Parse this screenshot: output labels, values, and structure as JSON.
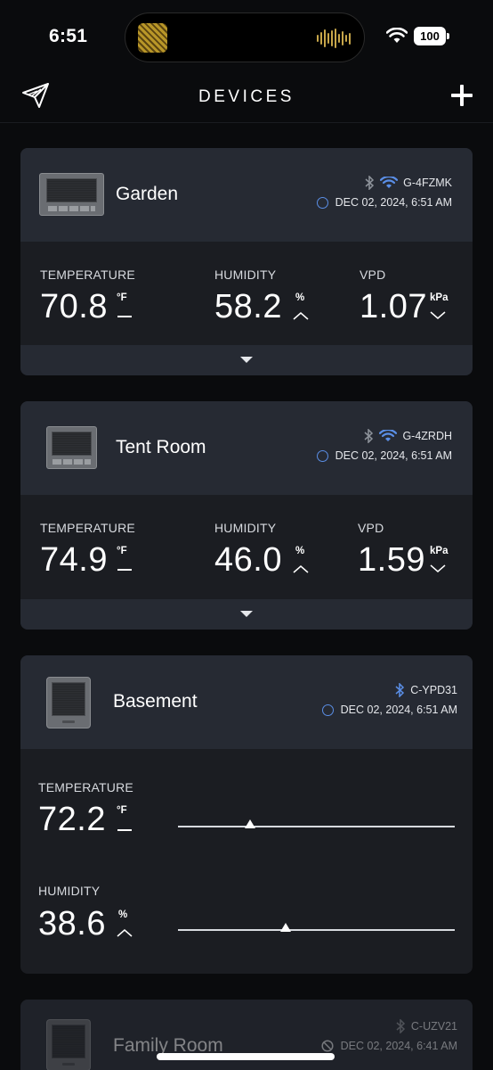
{
  "status_bar": {
    "time": "6:51",
    "battery": "100"
  },
  "nav": {
    "title": "DEVICES"
  },
  "labels": {
    "temperature": "TEMPERATURE",
    "humidity": "HUMIDITY",
    "vpd": "VPD"
  },
  "units": {
    "temp": "°F",
    "hum": "%",
    "vpd": "kPa"
  },
  "devices": [
    {
      "name": "Garden",
      "id": "G-4FZMK",
      "timestamp": "DEC 02, 2024, 6:51 AM",
      "temperature": "70.8",
      "humidity": "58.2",
      "vpd": "1.07",
      "temp_trend": "flat",
      "hum_trend": "up",
      "vpd_trend": "down"
    },
    {
      "name": "Tent Room",
      "id": "G-4ZRDH",
      "timestamp": "DEC 02, 2024, 6:51 AM",
      "temperature": "74.9",
      "humidity": "46.0",
      "vpd": "1.59",
      "temp_trend": "flat",
      "hum_trend": "up",
      "vpd_trend": "down"
    },
    {
      "name": "Basement",
      "id": "C-YPD31",
      "timestamp": "DEC 02, 2024, 6:51 AM",
      "temperature": "72.2",
      "humidity": "38.6",
      "temp_trend": "flat",
      "hum_trend": "up",
      "temp_slider_fraction": 0.26,
      "hum_slider_fraction": 0.39
    },
    {
      "name": "Family Room",
      "id": "C-UZV21",
      "timestamp": "DEC 02, 2024, 6:41 AM"
    }
  ],
  "colors": {
    "background": "#0a0b0d",
    "card": "#1b1d22",
    "card_header": "#262a33",
    "accent_blue": "#5a8ee6"
  }
}
